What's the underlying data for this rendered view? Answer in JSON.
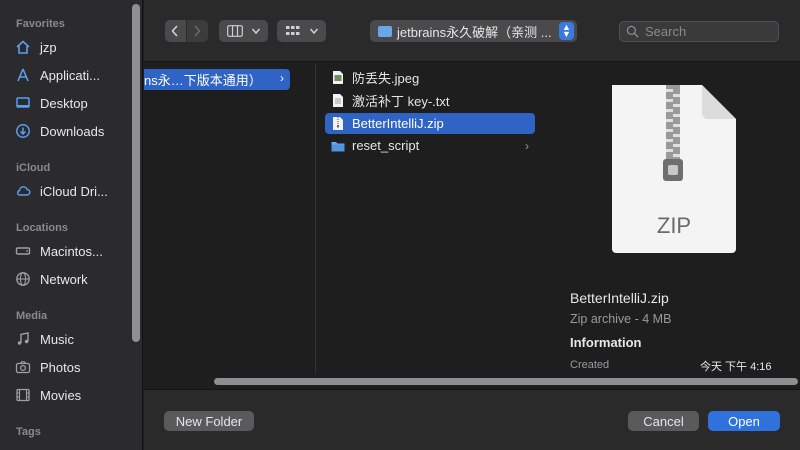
{
  "sidebar": {
    "sections": {
      "favorites": "Favorites",
      "icloud": "iCloud",
      "locations": "Locations",
      "media": "Media",
      "tags": "Tags"
    },
    "items": {
      "jzp": "jzp",
      "applications": "Applicati...",
      "desktop": "Desktop",
      "downloads": "Downloads",
      "icloud_drive": "iCloud Dri...",
      "macintosh": "Macintos...",
      "network": "Network",
      "music": "Music",
      "photos": "Photos",
      "movies": "Movies"
    }
  },
  "toolbar": {
    "path": "jetbrains永久破解（亲测 ...",
    "search_placeholder": "Search"
  },
  "browser": {
    "parent_folder": "ns永…下版本通用）",
    "files": [
      {
        "name": "防丢失.jpeg",
        "icon": "image-file-icon"
      },
      {
        "name": "激活补丁 key-.txt",
        "icon": "text-file-icon"
      },
      {
        "name": "BetterIntelliJ.zip",
        "icon": "zip-file-icon",
        "selected": true
      },
      {
        "name": "reset_script",
        "icon": "folder-icon",
        "folder": true
      }
    ]
  },
  "preview": {
    "badge": "ZIP",
    "name": "BetterIntelliJ.zip",
    "kind": "Zip archive - 4 MB",
    "info_heading": "Information",
    "created_label": "Created",
    "created_value": "今天 下午 4:16"
  },
  "buttons": {
    "new_folder": "New Folder",
    "cancel": "Cancel",
    "open": "Open"
  },
  "colors": {
    "accent": "#2f72de",
    "selection": "#2f63c4",
    "folder": "#67a9e8"
  }
}
